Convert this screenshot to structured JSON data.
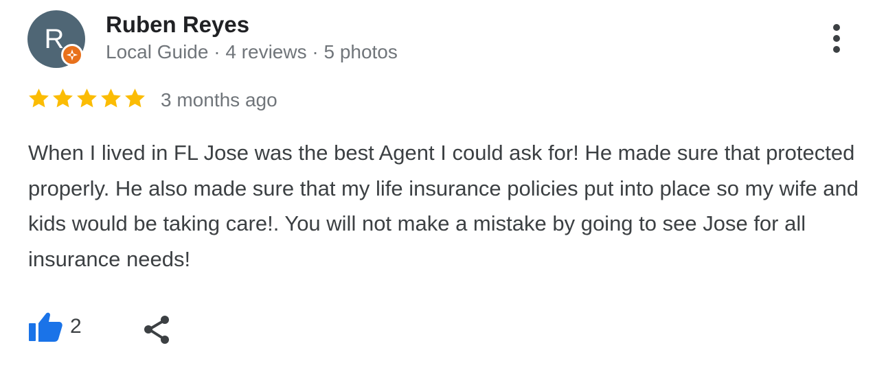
{
  "author": {
    "initial": "R",
    "name": "Ruben Reyes",
    "meta": "Local Guide · 4 reviews · 5 photos",
    "avatar_color": "#4f6675",
    "badge_color": "#e8711c",
    "badge_icon": "local-guide-star-icon"
  },
  "rating": {
    "stars": 5,
    "out_of": 5,
    "star_color": "#fbbc04"
  },
  "date": "3 months ago",
  "text": "When I lived in FL Jose was the best Agent I could ask for! He made sure that protected properly. He also made sure that my life insurance policies put into place so my wife and kids would be taking care!. You will not make a mistake by going to see Jose for all insurance needs!",
  "actions": {
    "like_count": "2",
    "like_icon": "thumbs-up-icon",
    "like_color": "#1a73e8",
    "share_icon": "share-icon",
    "more_icon": "more-vert-icon"
  }
}
